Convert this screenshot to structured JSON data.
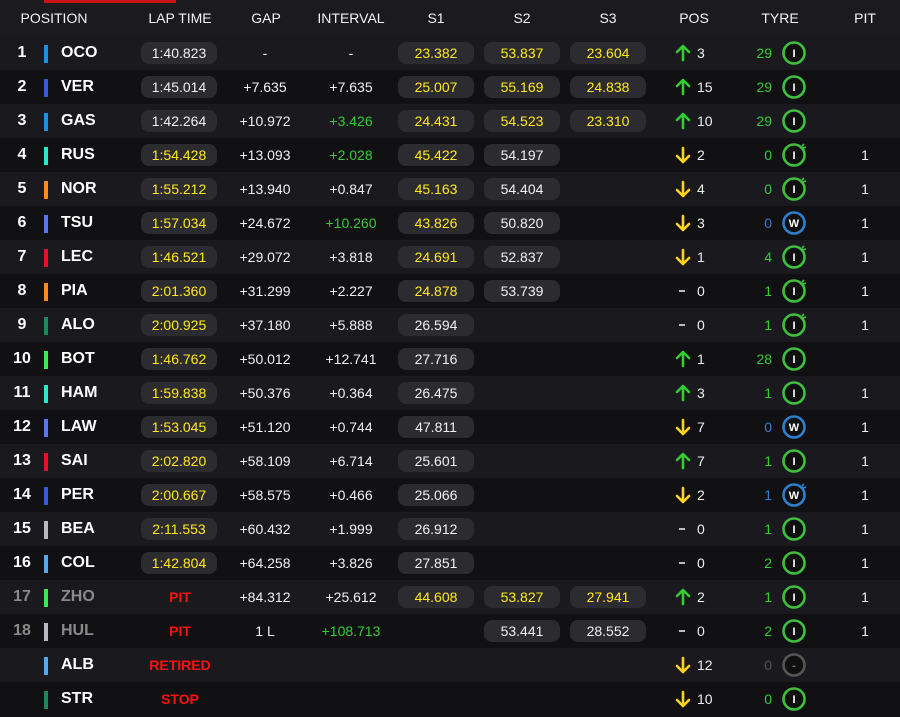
{
  "header": {
    "position": "POSITION",
    "lap_time": "LAP TIME",
    "gap": "GAP",
    "interval": "INTERVAL",
    "s1": "S1",
    "s2": "S2",
    "s3": "S3",
    "pos": "POS",
    "tyre": "TYRE",
    "pit": "PIT"
  },
  "colors": {
    "yellow": "#ffe81e",
    "green": "#33cc33",
    "red": "#ff1010",
    "personal_pill": "#2c2c30",
    "tyre_intermediate": "#3fbf3f",
    "tyre_wet": "#2f7fd0"
  },
  "rows": [
    {
      "pos": "1",
      "code": "OCO",
      "team_color": "#1f8fe0",
      "lap": "1:40.823",
      "lap_color": "w",
      "gap": "-",
      "interval": "-",
      "interval_color": "w",
      "s1": "23.382",
      "s1_color": "y",
      "s2": "53.837",
      "s2_color": "y",
      "s3": "23.604",
      "s3_color": "y",
      "dir": "up",
      "delta": "3",
      "tyre_laps": "29",
      "tyre_laps_color": "g",
      "tyre": "I",
      "tyre_type": "inter",
      "tyre_used": false,
      "pit": "",
      "dim": false,
      "status": ""
    },
    {
      "pos": "2",
      "code": "VER",
      "team_color": "#3b5bd6",
      "lap": "1:45.014",
      "lap_color": "w",
      "gap": "+7.635",
      "interval": "+7.635",
      "interval_color": "w",
      "s1": "25.007",
      "s1_color": "y",
      "s2": "55.169",
      "s2_color": "y",
      "s3": "24.838",
      "s3_color": "y",
      "dir": "up",
      "delta": "15",
      "tyre_laps": "29",
      "tyre_laps_color": "g",
      "tyre": "I",
      "tyre_type": "inter",
      "tyre_used": false,
      "pit": "",
      "dim": false,
      "status": ""
    },
    {
      "pos": "3",
      "code": "GAS",
      "team_color": "#1f8fe0",
      "lap": "1:42.264",
      "lap_color": "w",
      "gap": "+10.972",
      "interval": "+3.426",
      "interval_color": "g",
      "s1": "24.431",
      "s1_color": "y",
      "s2": "54.523",
      "s2_color": "y",
      "s3": "23.310",
      "s3_color": "y",
      "dir": "up",
      "delta": "10",
      "tyre_laps": "29",
      "tyre_laps_color": "g",
      "tyre": "I",
      "tyre_type": "inter",
      "tyre_used": false,
      "pit": "",
      "dim": false,
      "status": ""
    },
    {
      "pos": "4",
      "code": "RUS",
      "team_color": "#2ee6c8",
      "lap": "1:54.428",
      "lap_color": "y",
      "gap": "+13.093",
      "interval": "+2.028",
      "interval_color": "g",
      "s1": "45.422",
      "s1_color": "y",
      "s2": "54.197",
      "s2_color": "w",
      "s3": "",
      "s3_color": "w",
      "dir": "down",
      "delta": "2",
      "tyre_laps": "0",
      "tyre_laps_color": "g",
      "tyre": "I",
      "tyre_type": "inter",
      "tyre_used": true,
      "pit": "1",
      "dim": false,
      "status": ""
    },
    {
      "pos": "5",
      "code": "NOR",
      "team_color": "#ff8a1e",
      "lap": "1:55.212",
      "lap_color": "y",
      "gap": "+13.940",
      "interval": "+0.847",
      "interval_color": "w",
      "s1": "45.163",
      "s1_color": "y",
      "s2": "54.404",
      "s2_color": "w",
      "s3": "",
      "s3_color": "w",
      "dir": "down",
      "delta": "4",
      "tyre_laps": "0",
      "tyre_laps_color": "g",
      "tyre": "I",
      "tyre_type": "inter",
      "tyre_used": true,
      "pit": "1",
      "dim": false,
      "status": ""
    },
    {
      "pos": "6",
      "code": "TSU",
      "team_color": "#5a78e8",
      "lap": "1:57.034",
      "lap_color": "y",
      "gap": "+24.672",
      "interval": "+10.260",
      "interval_color": "g",
      "s1": "43.826",
      "s1_color": "y",
      "s2": "50.820",
      "s2_color": "w",
      "s3": "",
      "s3_color": "w",
      "dir": "down",
      "delta": "3",
      "tyre_laps": "0",
      "tyre_laps_color": "b",
      "tyre": "W",
      "tyre_type": "wet",
      "tyre_used": false,
      "pit": "1",
      "dim": false,
      "status": ""
    },
    {
      "pos": "7",
      "code": "LEC",
      "team_color": "#e8102a",
      "lap": "1:46.521",
      "lap_color": "y",
      "gap": "+29.072",
      "interval": "+3.818",
      "interval_color": "w",
      "s1": "24.691",
      "s1_color": "y",
      "s2": "52.837",
      "s2_color": "w",
      "s3": "",
      "s3_color": "w",
      "dir": "down",
      "delta": "1",
      "tyre_laps": "4",
      "tyre_laps_color": "g",
      "tyre": "I",
      "tyre_type": "inter",
      "tyre_used": true,
      "pit": "1",
      "dim": false,
      "status": ""
    },
    {
      "pos": "8",
      "code": "PIA",
      "team_color": "#ff8a1e",
      "lap": "2:01.360",
      "lap_color": "y",
      "gap": "+31.299",
      "interval": "+2.227",
      "interval_color": "w",
      "s1": "24.878",
      "s1_color": "y",
      "s2": "53.739",
      "s2_color": "w",
      "s3": "",
      "s3_color": "w",
      "dir": "none",
      "delta": "0",
      "tyre_laps": "1",
      "tyre_laps_color": "g",
      "tyre": "I",
      "tyre_type": "inter",
      "tyre_used": true,
      "pit": "1",
      "dim": false,
      "status": ""
    },
    {
      "pos": "9",
      "code": "ALO",
      "team_color": "#1e8a5a",
      "lap": "2:00.925",
      "lap_color": "y",
      "gap": "+37.180",
      "interval": "+5.888",
      "interval_color": "w",
      "s1": "26.594",
      "s1_color": "w",
      "s2": "",
      "s2_color": "w",
      "s3": "",
      "s3_color": "w",
      "dir": "none",
      "delta": "0",
      "tyre_laps": "1",
      "tyre_laps_color": "g",
      "tyre": "I",
      "tyre_type": "inter",
      "tyre_used": true,
      "pit": "1",
      "dim": false,
      "status": ""
    },
    {
      "pos": "10",
      "code": "BOT",
      "team_color": "#3ee65a",
      "lap": "1:46.762",
      "lap_color": "y",
      "gap": "+50.012",
      "interval": "+12.741",
      "interval_color": "w",
      "s1": "27.716",
      "s1_color": "w",
      "s2": "",
      "s2_color": "w",
      "s3": "",
      "s3_color": "w",
      "dir": "up",
      "delta": "1",
      "tyre_laps": "28",
      "tyre_laps_color": "g",
      "tyre": "I",
      "tyre_type": "inter",
      "tyre_used": false,
      "pit": "",
      "dim": false,
      "status": ""
    },
    {
      "pos": "11",
      "code": "HAM",
      "team_color": "#2ee6c8",
      "lap": "1:59.838",
      "lap_color": "y",
      "gap": "+50.376",
      "interval": "+0.364",
      "interval_color": "w",
      "s1": "26.475",
      "s1_color": "w",
      "s2": "",
      "s2_color": "w",
      "s3": "",
      "s3_color": "w",
      "dir": "up",
      "delta": "3",
      "tyre_laps": "1",
      "tyre_laps_color": "g",
      "tyre": "I",
      "tyre_type": "inter",
      "tyre_used": false,
      "pit": "1",
      "dim": false,
      "status": ""
    },
    {
      "pos": "12",
      "code": "LAW",
      "team_color": "#5a78e8",
      "lap": "1:53.045",
      "lap_color": "y",
      "gap": "+51.120",
      "interval": "+0.744",
      "interval_color": "w",
      "s1": "47.811",
      "s1_color": "w",
      "s2": "",
      "s2_color": "w",
      "s3": "",
      "s3_color": "w",
      "dir": "down",
      "delta": "7",
      "tyre_laps": "0",
      "tyre_laps_color": "b",
      "tyre": "W",
      "tyre_type": "wet",
      "tyre_used": false,
      "pit": "1",
      "dim": false,
      "status": ""
    },
    {
      "pos": "13",
      "code": "SAI",
      "team_color": "#e8102a",
      "lap": "2:02.820",
      "lap_color": "y",
      "gap": "+58.109",
      "interval": "+6.714",
      "interval_color": "w",
      "s1": "25.601",
      "s1_color": "w",
      "s2": "",
      "s2_color": "w",
      "s3": "",
      "s3_color": "w",
      "dir": "up",
      "delta": "7",
      "tyre_laps": "1",
      "tyre_laps_color": "g",
      "tyre": "I",
      "tyre_type": "inter",
      "tyre_used": false,
      "pit": "1",
      "dim": false,
      "status": ""
    },
    {
      "pos": "14",
      "code": "PER",
      "team_color": "#3b5bd6",
      "lap": "2:00.667",
      "lap_color": "y",
      "gap": "+58.575",
      "interval": "+0.466",
      "interval_color": "w",
      "s1": "25.066",
      "s1_color": "w",
      "s2": "",
      "s2_color": "w",
      "s3": "",
      "s3_color": "w",
      "dir": "down",
      "delta": "2",
      "tyre_laps": "1",
      "tyre_laps_color": "b",
      "tyre": "W",
      "tyre_type": "wet",
      "tyre_used": true,
      "pit": "1",
      "dim": false,
      "status": ""
    },
    {
      "pos": "15",
      "code": "BEA",
      "team_color": "#b8b8c0",
      "lap": "2:11.553",
      "lap_color": "y",
      "gap": "+60.432",
      "interval": "+1.999",
      "interval_color": "w",
      "s1": "26.912",
      "s1_color": "w",
      "s2": "",
      "s2_color": "w",
      "s3": "",
      "s3_color": "w",
      "dir": "none",
      "delta": "0",
      "tyre_laps": "1",
      "tyre_laps_color": "g",
      "tyre": "I",
      "tyre_type": "inter",
      "tyre_used": false,
      "pit": "1",
      "dim": false,
      "status": ""
    },
    {
      "pos": "16",
      "code": "COL",
      "team_color": "#5aa8e8",
      "lap": "1:42.804",
      "lap_color": "y",
      "gap": "+64.258",
      "interval": "+3.826",
      "interval_color": "w",
      "s1": "27.851",
      "s1_color": "w",
      "s2": "",
      "s2_color": "w",
      "s3": "",
      "s3_color": "w",
      "dir": "none",
      "delta": "0",
      "tyre_laps": "2",
      "tyre_laps_color": "g",
      "tyre": "I",
      "tyre_type": "inter",
      "tyre_used": false,
      "pit": "1",
      "dim": false,
      "status": ""
    },
    {
      "pos": "17",
      "code": "ZHO",
      "team_color": "#3ee65a",
      "lap": "",
      "lap_color": "w",
      "gap": "+84.312",
      "interval": "+25.612",
      "interval_color": "w",
      "s1": "44.608",
      "s1_color": "y",
      "s2": "53.827",
      "s2_color": "y",
      "s3": "27.941",
      "s3_color": "y",
      "dir": "up",
      "delta": "2",
      "tyre_laps": "1",
      "tyre_laps_color": "g",
      "tyre": "I",
      "tyre_type": "inter",
      "tyre_used": false,
      "pit": "1",
      "dim": true,
      "status": "PIT"
    },
    {
      "pos": "18",
      "code": "HUL",
      "team_color": "#b8b8c0",
      "lap": "",
      "lap_color": "w",
      "gap": "1 L",
      "interval": "+108.713",
      "interval_color": "g",
      "s1": "",
      "s1_color": "w",
      "s2": "53.441",
      "s2_color": "w",
      "s3": "28.552",
      "s3_color": "w",
      "dir": "none",
      "delta": "0",
      "tyre_laps": "2",
      "tyre_laps_color": "g",
      "tyre": "I",
      "tyre_type": "inter",
      "tyre_used": false,
      "pit": "1",
      "dim": true,
      "status": "PIT"
    },
    {
      "pos": "",
      "code": "ALB",
      "team_color": "#5aa8e8",
      "lap": "",
      "lap_color": "w",
      "gap": "",
      "interval": "",
      "interval_color": "w",
      "s1": "",
      "s1_color": "w",
      "s2": "",
      "s2_color": "w",
      "s3": "",
      "s3_color": "w",
      "dir": "down",
      "delta": "12",
      "tyre_laps": "0",
      "tyre_laps_color": "d",
      "tyre": "-",
      "tyre_type": "none",
      "tyre_used": false,
      "pit": "",
      "dim": false,
      "status": "RETIRED"
    },
    {
      "pos": "",
      "code": "STR",
      "team_color": "#1e8a5a",
      "lap": "",
      "lap_color": "w",
      "gap": "",
      "interval": "",
      "interval_color": "w",
      "s1": "",
      "s1_color": "w",
      "s2": "",
      "s2_color": "w",
      "s3": "",
      "s3_color": "w",
      "dir": "down",
      "delta": "10",
      "tyre_laps": "0",
      "tyre_laps_color": "g",
      "tyre": "I",
      "tyre_type": "inter",
      "tyre_used": false,
      "pit": "",
      "dim": false,
      "status": "STOP"
    }
  ]
}
